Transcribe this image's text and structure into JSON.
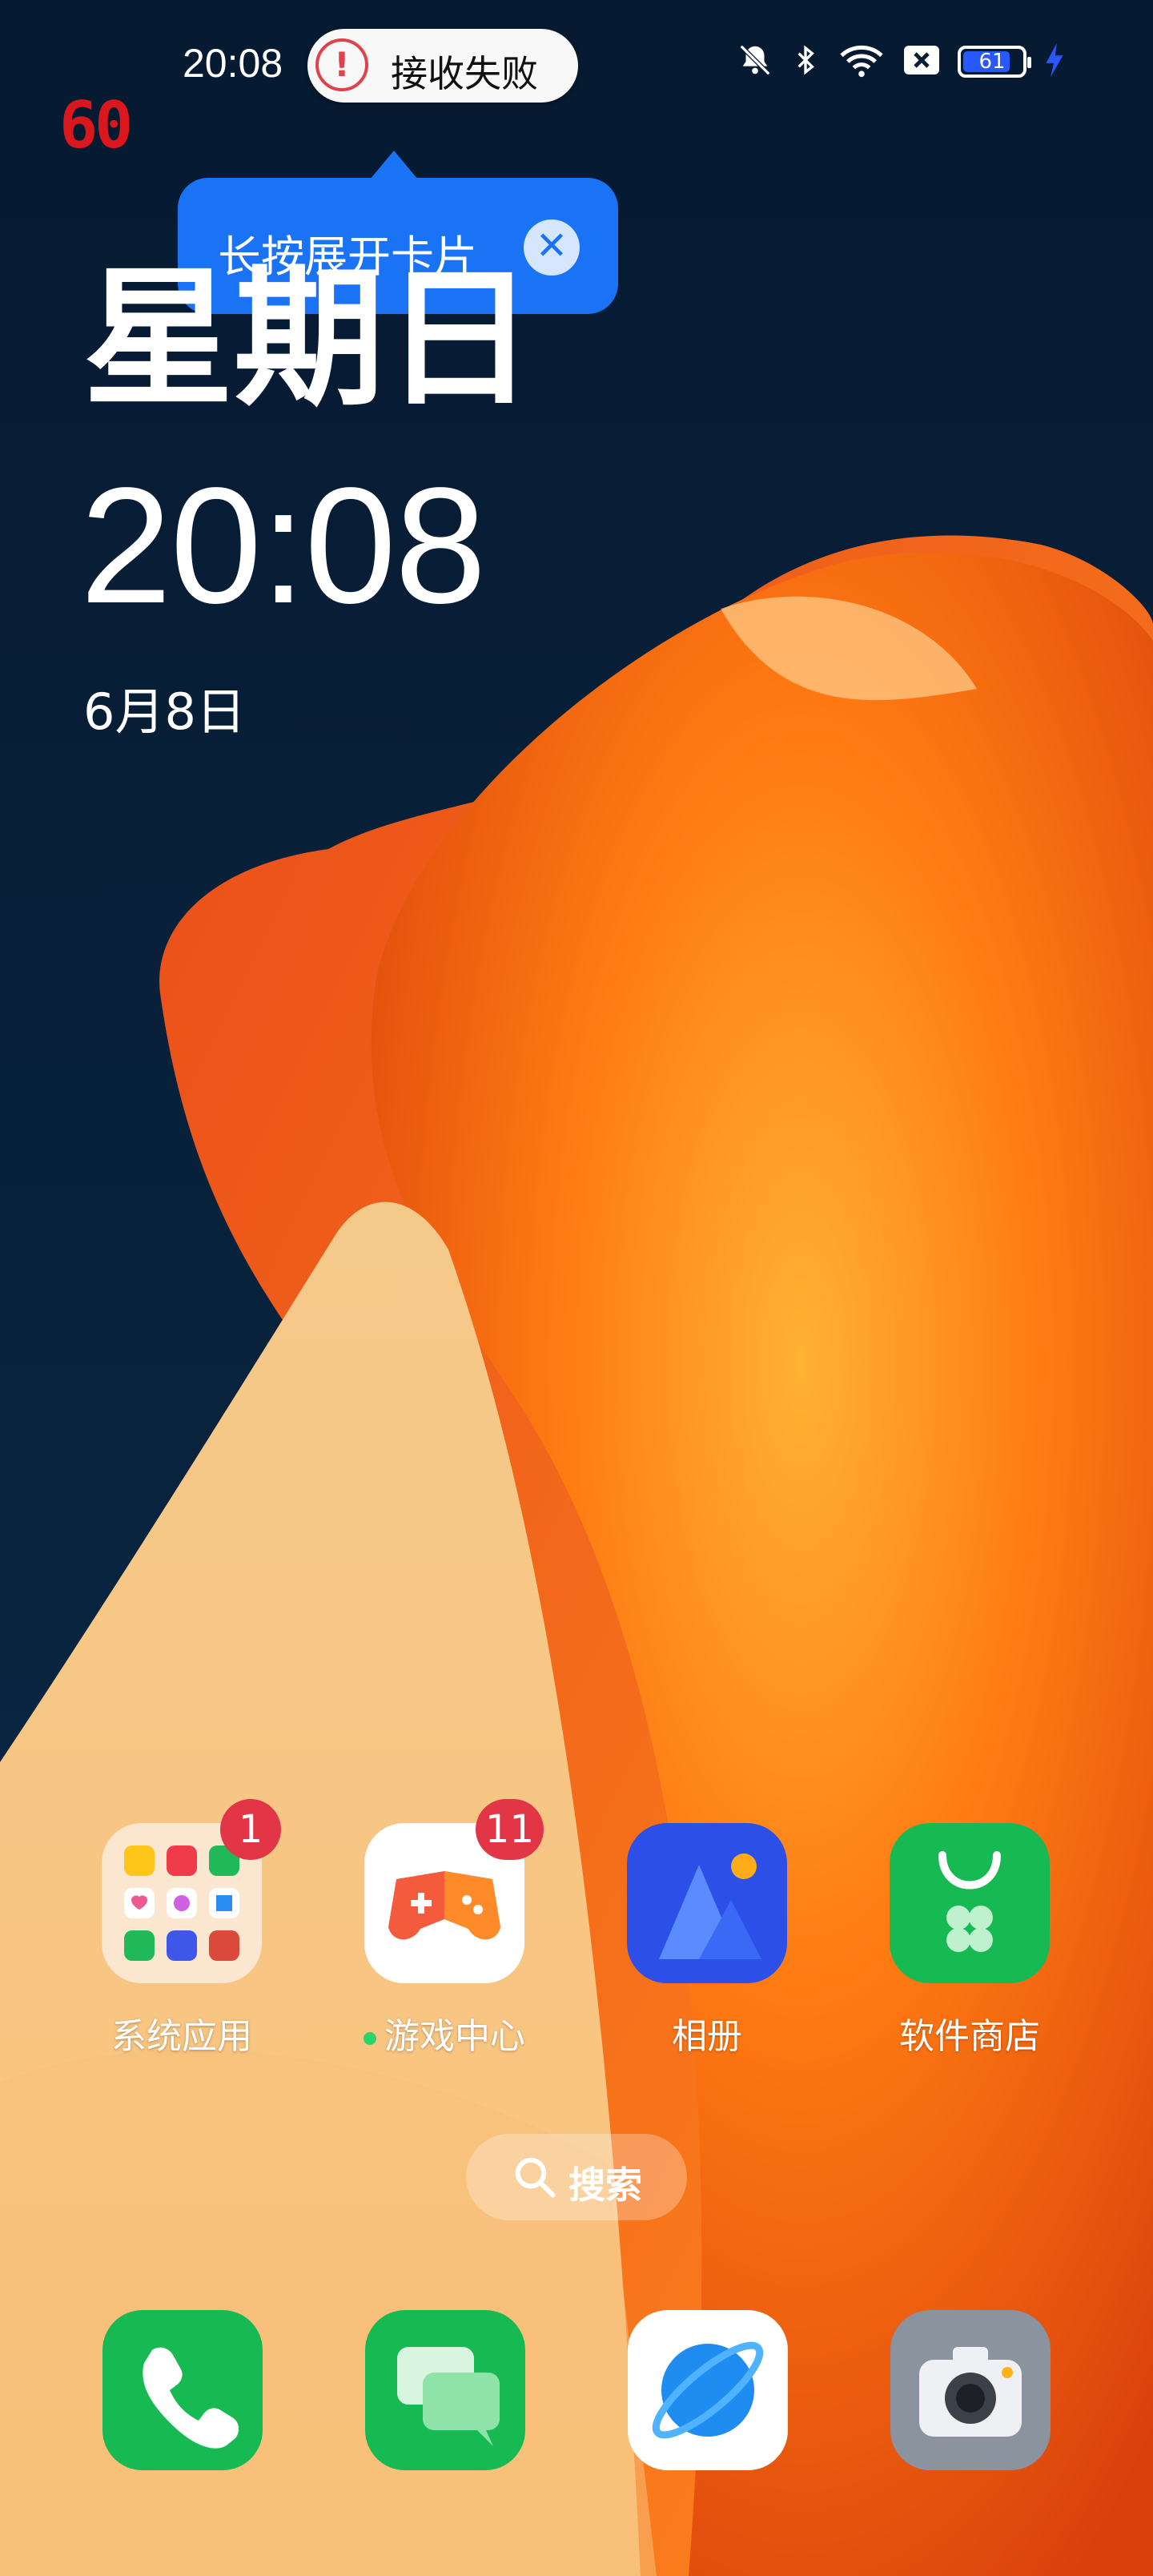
{
  "status_bar": {
    "time": "20:08",
    "notification_text": "接收失败",
    "battery_level": "61",
    "fps_counter": "60"
  },
  "tooltip": {
    "text": "长按展开卡片"
  },
  "lock_widget": {
    "weekday": "星期日",
    "time": "20:08",
    "date": "6月8日"
  },
  "apps": [
    {
      "label": "系统应用",
      "badge": "1"
    },
    {
      "label": "游戏中心",
      "badge": "11"
    },
    {
      "label": "相册"
    },
    {
      "label": "软件商店"
    }
  ],
  "search": {
    "label": "搜索"
  },
  "dock": [
    "phone-icon",
    "messages-icon",
    "browser-icon",
    "camera-icon"
  ],
  "colors": {
    "background": "#071d36",
    "accent_blue": "#1a73f5",
    "badge_red": "#e23545",
    "store_green": "#17b953"
  }
}
